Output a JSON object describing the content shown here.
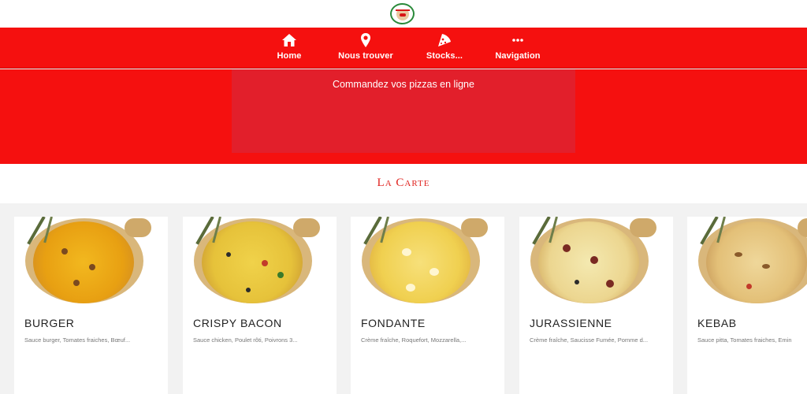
{
  "nav": {
    "items": [
      {
        "label": "Home",
        "icon": "home-icon"
      },
      {
        "label": "Nous trouver",
        "icon": "location-pin-icon"
      },
      {
        "label": "Stocks...",
        "icon": "pizza-slice-icon"
      },
      {
        "label": "Navigation",
        "icon": "more-dots-icon"
      }
    ]
  },
  "hero": {
    "text": "Commandez vos pizzas en ligne"
  },
  "section": {
    "title": "La Carte"
  },
  "colors": {
    "brand_red": "#f5100f",
    "title_red": "#e0231f"
  },
  "products": [
    {
      "name": "BURGER",
      "description": "Sauce burger, Tomates fraiches, Bœuf..."
    },
    {
      "name": "CRISPY BACON",
      "description": "Sauce chicken, Poulet rôti, Poivrons 3..."
    },
    {
      "name": "FONDANTE",
      "description": "Crème fraîche, Roquefort, Mozzarella,..."
    },
    {
      "name": "JURASSIENNE",
      "description": "Crème fraîche, Saucisse Fumée, Pomme d..."
    },
    {
      "name": "KEBAB",
      "description": "Sauce pitta, Tomates fraiches, Emin"
    }
  ]
}
